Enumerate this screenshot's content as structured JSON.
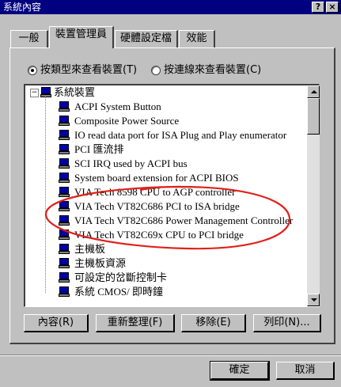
{
  "window": {
    "title": "系統內容",
    "help_btn": "?",
    "close_btn": "×"
  },
  "tabs": [
    {
      "label": "一般"
    },
    {
      "label": "裝置管理員"
    },
    {
      "label": "硬體設定檔"
    },
    {
      "label": "效能"
    }
  ],
  "view_options": {
    "by_type": "按類型來查看裝置(T)",
    "by_connection": "按連線來查看裝置(C)",
    "selected": "by_type"
  },
  "tree": {
    "root": {
      "expander": "−",
      "label": "系統裝置"
    },
    "items": [
      {
        "label": "ACPI System Button"
      },
      {
        "label": "Composite Power Source"
      },
      {
        "label": "IO read data port for ISA Plug and Play enumerator"
      },
      {
        "label": "PCI 匯流排"
      },
      {
        "label": "SCI IRQ used by ACPI bus"
      },
      {
        "label": "System board extension for ACPI BIOS"
      },
      {
        "label": "VIA Tech 8598 CPU to AGP controller"
      },
      {
        "label": "VIA Tech VT82C686 PCI to ISA bridge"
      },
      {
        "label": "VIA Tech VT82C686 Power Management Controller"
      },
      {
        "label": "VIA Tech VT82C69x CPU to PCI bridge"
      },
      {
        "label": "主機板"
      },
      {
        "label": "主機板資源"
      },
      {
        "label": "可設定的岔斷控制卡"
      },
      {
        "label": "系統 CMOS/ 即時鐘"
      }
    ]
  },
  "action_buttons": {
    "properties": "內容(R)",
    "refresh": "重新整理(F)",
    "remove": "移除(E)",
    "print": "列印(N)..."
  },
  "dialog_buttons": {
    "ok": "確定",
    "cancel": "取消"
  },
  "colors": {
    "titlebar": "#000080",
    "face": "#c0c0c0",
    "annotation": "#e0201a"
  },
  "icons": {
    "device": "monitor-icon"
  }
}
